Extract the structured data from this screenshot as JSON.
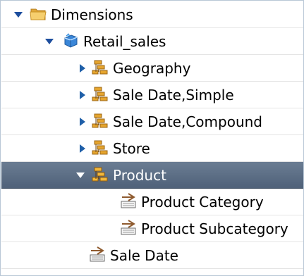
{
  "colors": {
    "selected_row_bg": "#566880",
    "selected_text": "#ffffff",
    "arrow_expanded": "#1d4e9e",
    "arrow_collapsed": "#1f5fa8",
    "folder": "#f2c45a",
    "cube": "#3a86d8",
    "hierarchy": "#d9a02a",
    "level": "#8f5b2f"
  },
  "tree": {
    "nodes": [
      {
        "label": "Dimensions",
        "icon": "folder-icon",
        "expanded": true,
        "selected": false
      },
      {
        "label": "Retail_sales",
        "icon": "cube-icon",
        "expanded": true,
        "selected": false
      },
      {
        "label": "Geography",
        "icon": "hierarchy-icon",
        "expanded": false,
        "selected": false
      },
      {
        "label": "Sale Date,Simple",
        "icon": "hierarchy-icon",
        "expanded": false,
        "selected": false
      },
      {
        "label": "Sale Date,Compound",
        "icon": "hierarchy-icon",
        "expanded": false,
        "selected": false
      },
      {
        "label": "Store",
        "icon": "hierarchy-icon",
        "expanded": false,
        "selected": false
      },
      {
        "label": "Product",
        "icon": "hierarchy-icon",
        "expanded": true,
        "selected": true
      },
      {
        "label": "Product Category",
        "icon": "level-icon",
        "expanded": null,
        "selected": false
      },
      {
        "label": "Product Subcategory",
        "icon": "level-icon",
        "expanded": null,
        "selected": false
      },
      {
        "label": "Sale Date",
        "icon": "level-icon",
        "expanded": null,
        "selected": false
      }
    ]
  }
}
